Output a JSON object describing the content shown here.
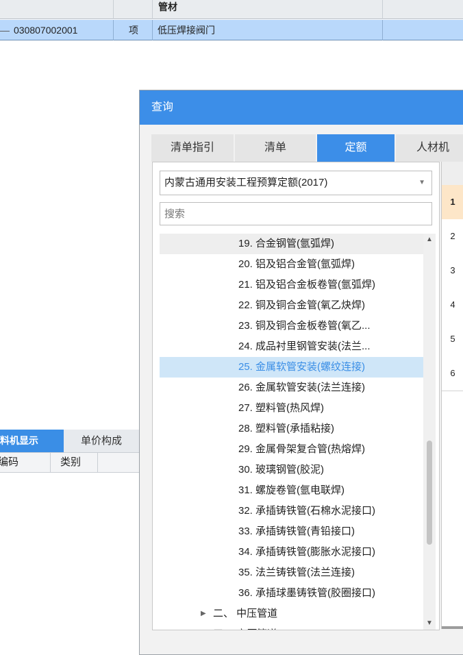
{
  "table": {
    "header_col_name": "管材",
    "row": {
      "code": "030807002001",
      "type": "项",
      "name": "低压焊接阀门"
    }
  },
  "bottom_left": {
    "tabs": [
      "料机显示",
      "单价构成"
    ],
    "columns": [
      "编码",
      "类别"
    ]
  },
  "dialog": {
    "title": "查询",
    "tabs": [
      "清单指引",
      "清单",
      "定额",
      "人材机"
    ],
    "active_tab": "定额",
    "quota_select": "内蒙古通用安装工程预算定额(2017)",
    "search_placeholder": "搜索",
    "tree_items": [
      "19. 合金钢管(氩弧焊)",
      "20. 铝及铝合金管(氩弧焊)",
      "21. 铝及铝合金板卷管(氩弧焊)",
      "22. 铜及铜合金管(氧乙炔焊)",
      "23. 铜及铜合金板卷管(氧乙...",
      "24. 成品衬里钢管安装(法兰...",
      "25. 金属软管安装(螺纹连接)",
      "26. 金属软管安装(法兰连接)",
      "27. 塑料管(热风焊)",
      "28. 塑料管(承插粘接)",
      "29. 金属骨架复合管(热熔焊)",
      "30. 玻璃钢管(胶泥)",
      "31. 螺旋卷管(氩电联焊)",
      "32. 承插铸铁管(石棉水泥接口)",
      "33. 承插铸铁管(青铅接口)",
      "34. 承插铸铁管(膨胀水泥接口)",
      "35. 法兰铸铁管(法兰连接)",
      "36. 承插球墨铸铁管(胶圈接口)"
    ],
    "selected_item": "25. 金属软管安装(螺纹连接)",
    "groups": [
      "二、 中压管道",
      "三、 高压管道"
    ],
    "row_numbers": [
      "1",
      "2",
      "3",
      "4",
      "5",
      "6"
    ]
  },
  "icons": {
    "dropdown": "chevron-down-icon",
    "expand": "triangle-right-icon",
    "scroll_up": "triangle-up-icon",
    "scroll_down": "triangle-down-icon"
  },
  "colors": {
    "accent": "#3c8ee8",
    "row_selected": "#b9d8fb",
    "tree_selected": "#cfe6f8",
    "active_row_num": "#fde6c8"
  }
}
